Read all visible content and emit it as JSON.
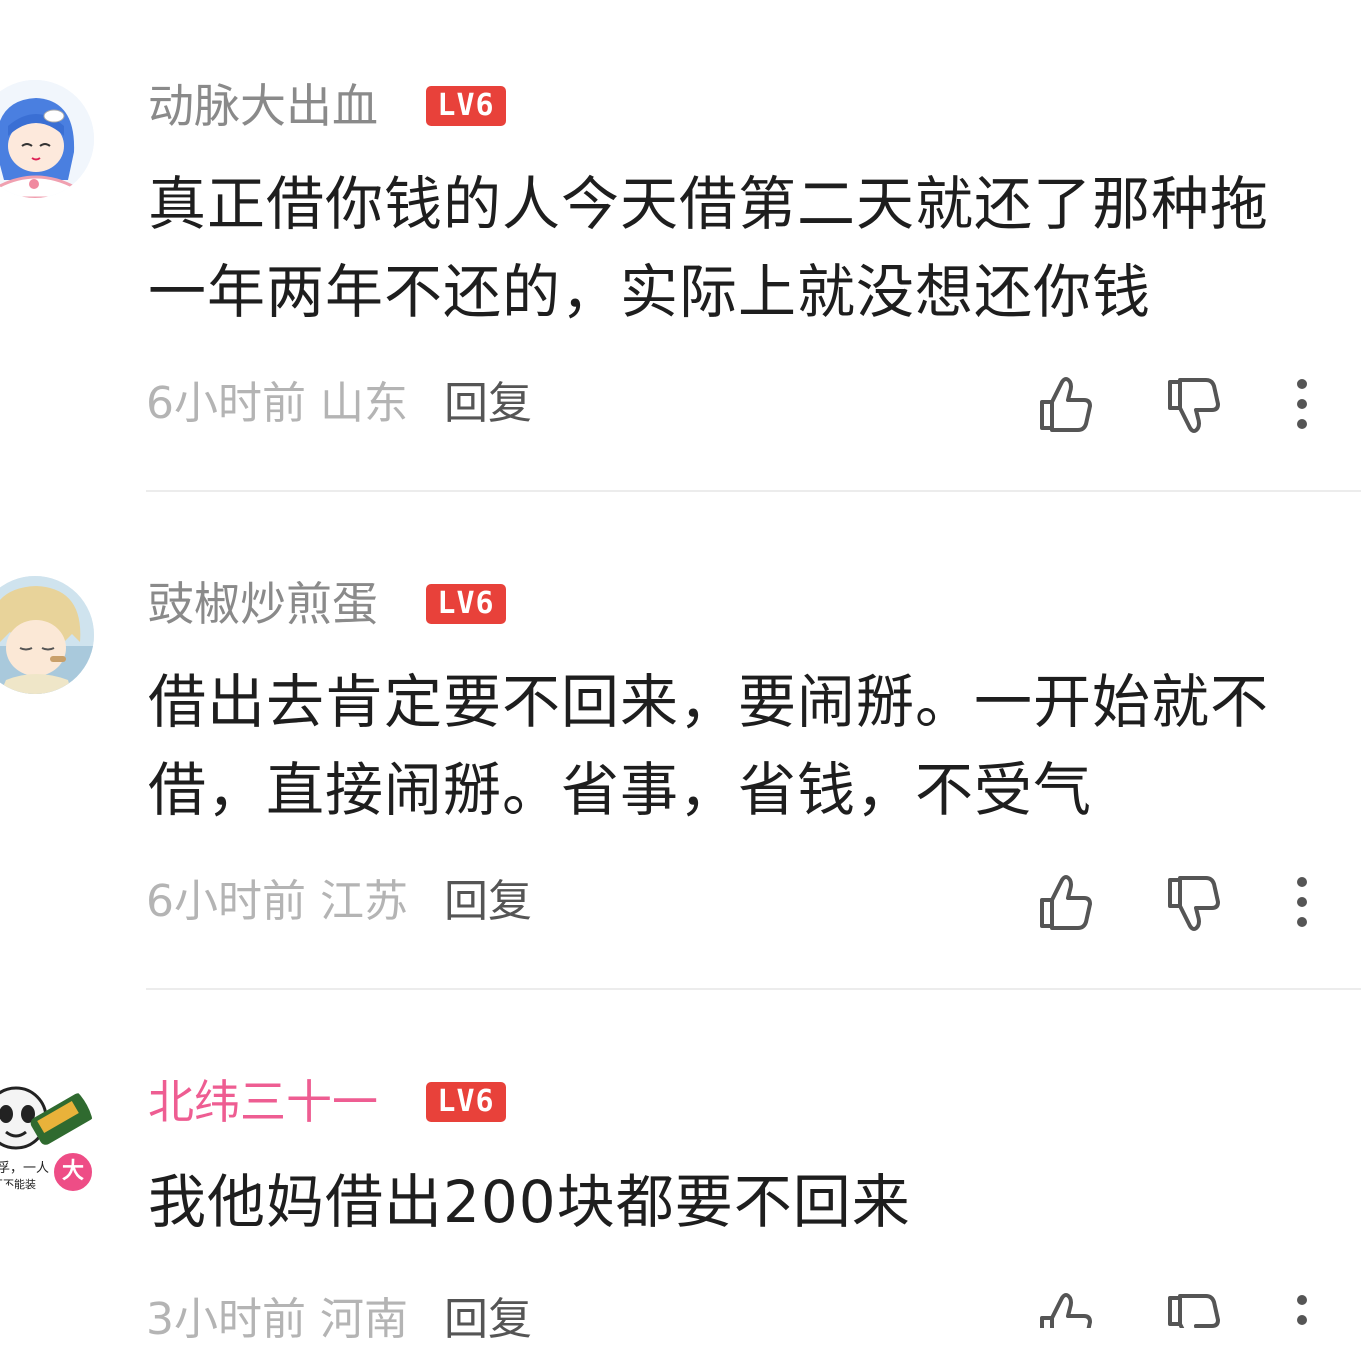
{
  "comments": [
    {
      "username": "动脉大出血",
      "level": "LV6",
      "content": "真正借你钱的人今天借第二天就还了那种拖一年两年不还的，实际上就没想还你钱",
      "time": "6小时前",
      "location": "山东",
      "reply_label": "回复",
      "avatar": "anime-girl-avatar"
    },
    {
      "username": "豉椒炒煎蛋",
      "level": "LV6",
      "content": "借出去肯定要不回来，要闹掰。一开始就不借，直接闹掰。省事，省钱，不受气",
      "time": "6小时前",
      "location": "江苏",
      "reply_label": "回复",
      "avatar": "anime-boy-avatar"
    },
    {
      "username": "北纬三十一",
      "level": "LV6",
      "badge": "大",
      "content": "我他妈借出200块都要不回来",
      "time": "3小时前",
      "location": "河南",
      "reply_label": "回复",
      "avatar": "panda-meme-avatar"
    }
  ],
  "colors": {
    "level_badge": "#e8413a",
    "vip_name": "#ee5d92",
    "badge_pink": "#ee4d86"
  },
  "icons": {
    "like": "thumbs-up-icon",
    "dislike": "thumbs-down-icon",
    "more": "more-vertical-icon"
  }
}
